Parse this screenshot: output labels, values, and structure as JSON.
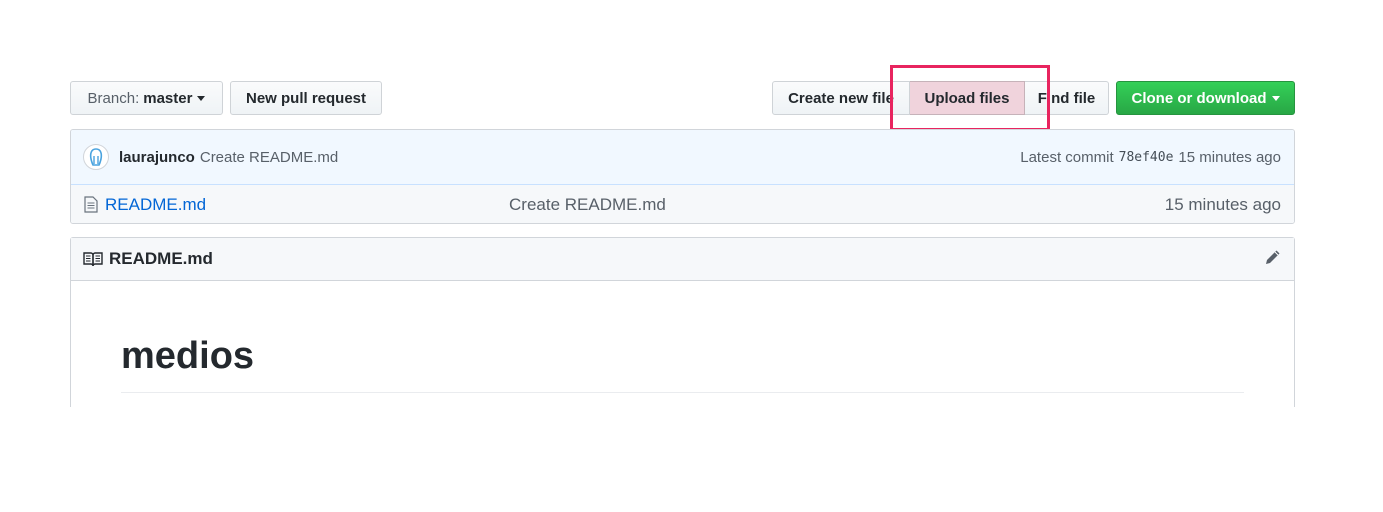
{
  "toolbar": {
    "branch_prefix": "Branch:",
    "branch_name": "master",
    "new_pr_label": "New pull request",
    "create_file_label": "Create new file",
    "upload_files_label": "Upload files",
    "find_file_label": "Find file",
    "clone_label": "Clone or download"
  },
  "commit": {
    "author": "laurajunco",
    "message": "Create README.md",
    "latest_label": "Latest commit",
    "sha": "78ef40e",
    "age": "15 minutes ago"
  },
  "files": [
    {
      "name": "README.md",
      "message": "Create README.md",
      "age": "15 minutes ago"
    }
  ],
  "readme": {
    "title": "README.md",
    "heading": "medios"
  },
  "icons": {
    "avatar": "user-avatar",
    "file": "file-icon",
    "book": "book-icon",
    "edit": "pencil-icon"
  },
  "colors": {
    "clone_button": "#28a745",
    "link": "#0366d6",
    "highlight_box": "#e8245f",
    "commit_bar": "#f1f8ff"
  }
}
